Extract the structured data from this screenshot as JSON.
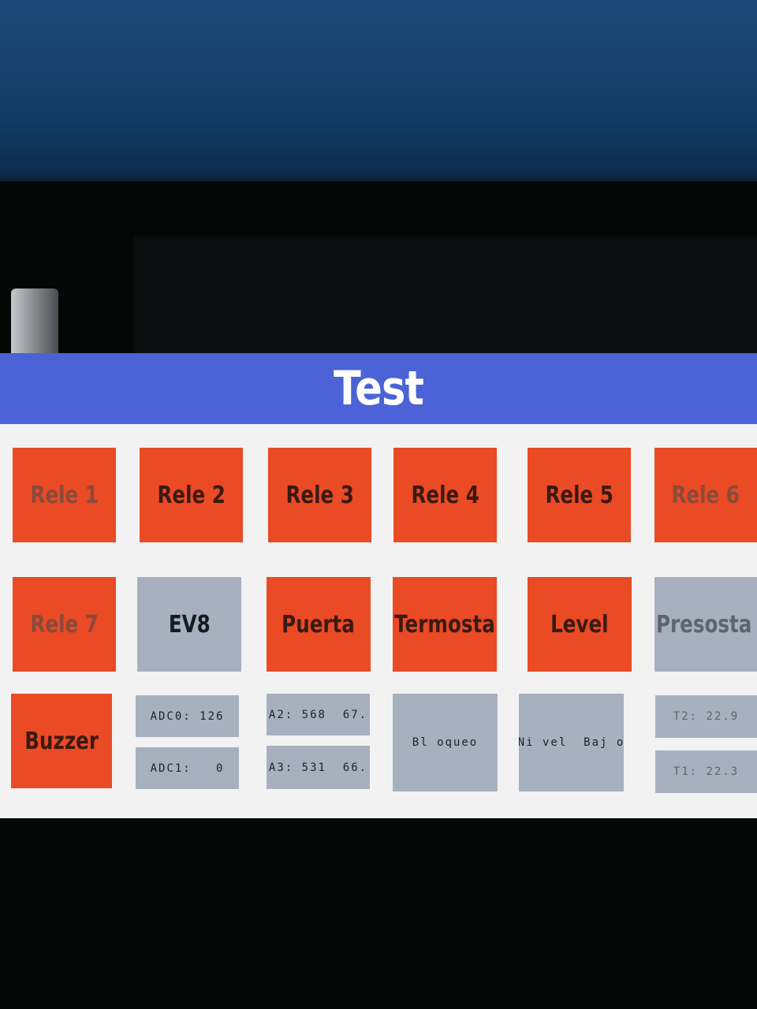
{
  "header": {
    "title": "Test"
  },
  "tiles": {
    "rele1": "Rele 1",
    "rele2": "Rele 2",
    "rele3": "Rele 3",
    "rele4": "Rele 4",
    "rele5": "Rele 5",
    "rele6": "Rele 6",
    "rele7": "Rele 7",
    "ev8": "EV8",
    "puerta": "Puerta",
    "termosta": "Termosta",
    "level": "Level",
    "presosta": "Presosta",
    "buzzer": "Buzzer",
    "adc0": "ADC0: 126",
    "adc1": "ADC1:   0",
    "a2": "A2: 568  67.",
    "a3": "A3: 531  66.",
    "bloqueo": "Bl oqueo",
    "nivel_bajo": "Ni vel  Baj o",
    "t2": "T2: 22.9",
    "t1": "T1: 22.3"
  },
  "colors": {
    "header": "#4b63d6",
    "active": "#ea4a24",
    "inactive": "#a7b0bf",
    "background": "#f2f2f3"
  }
}
